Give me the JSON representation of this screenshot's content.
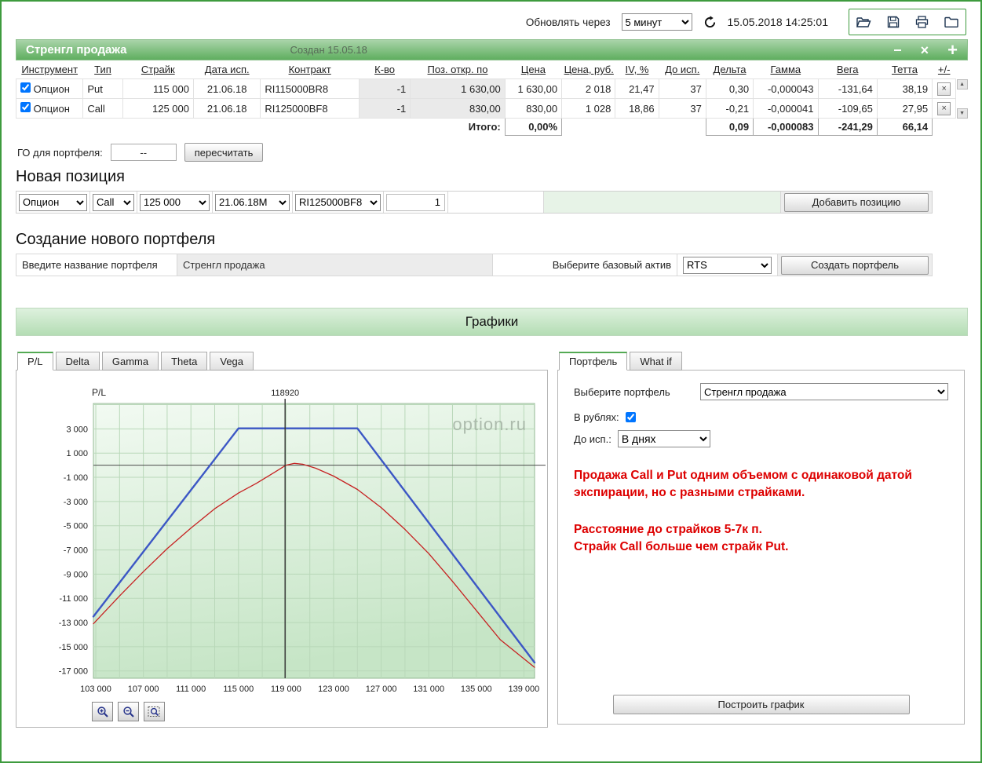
{
  "topbar": {
    "refresh_label": "Обновлять через",
    "refresh_value": "5 минут",
    "datetime": "15.05.2018 14:25:01"
  },
  "glyphs": {
    "scroll_up": "▲",
    "scroll_down": "▼",
    "row_delete": "×",
    "minimize": "−",
    "close": "×",
    "add": "+"
  },
  "portfolio": {
    "title": "Стренгл продажа",
    "created": "Создан 15.05.18",
    "table": {
      "columns": [
        "Инструмент",
        "Тип",
        "Страйк",
        "Дата исп.",
        "Контракт",
        "К-во",
        "Поз. откр. по",
        "Цена",
        "Цена, руб.",
        "IV, %",
        "До исп.",
        "Дельта",
        "Гамма",
        "Вега",
        "Тетта",
        "+/-"
      ],
      "rows": [
        {
          "checked": true,
          "instrument": "Опцион",
          "type": "Put",
          "strike": "115 000",
          "exp_date": "21.06.18",
          "contract": "RI115000BR8",
          "qty": "-1",
          "open_pos": "1 630,00",
          "price": "1 630,00",
          "price_rub": "2 018",
          "iv": "21,47",
          "days": "37",
          "delta": "0,30",
          "gamma": "-0,000043",
          "vega": "-131,64",
          "theta": "38,19"
        },
        {
          "checked": true,
          "instrument": "Опцион",
          "type": "Call",
          "strike": "125 000",
          "exp_date": "21.06.18",
          "contract": "RI125000BF8",
          "qty": "-1",
          "open_pos": "830,00",
          "price": "830,00",
          "price_rub": "1 028",
          "iv": "18,86",
          "days": "37",
          "delta": "-0,21",
          "gamma": "-0,000041",
          "vega": "-109,65",
          "theta": "27,95"
        }
      ],
      "totals": {
        "label": "Итого:",
        "percent": "0,00%",
        "delta": "0,09",
        "gamma": "-0,000083",
        "vega": "-241,29",
        "theta": "66,14"
      }
    },
    "go_label": "ГО для портфеля:",
    "go_value": "--",
    "recalc_button": "пересчитать"
  },
  "new_position": {
    "title": "Новая позиция",
    "instrument": "Опцион",
    "option_type": "Call",
    "strike": "125 000",
    "date": "21.06.18M",
    "contract": "RI125000BF8",
    "qty": "1",
    "add_button": "Добавить позицию"
  },
  "create_portfolio": {
    "title": "Создание нового портфеля",
    "name_label": "Введите название портфеля",
    "name_value": "Стренгл продажа",
    "asset_label": "Выберите базовый актив",
    "asset_value": "RTS",
    "create_button": "Создать портфель"
  },
  "charts_section": {
    "band_title": "Графики",
    "left_tabs": [
      "P/L",
      "Delta",
      "Gamma",
      "Theta",
      "Vega"
    ],
    "active_left_tab": "P/L"
  },
  "right_panel": {
    "tabs": [
      "Портфель",
      "What if"
    ],
    "active_tab": "Портфель",
    "select_portfolio_label": "Выберите портфель",
    "select_portfolio_value": "Стренгл продажа",
    "rub_label": "В рублях:",
    "rub_checked": true,
    "days_label": "До исп.:",
    "days_value": "В днях",
    "note1": "Продажа Call и Put одним объемом с одинаковой датой экспирации, но с разными страйками.",
    "note2": "Расстояние до страйков 5-7к п.",
    "note3": "Страйк Call больше чем страйк Put.",
    "build_button": "Построить график"
  },
  "chart_data": {
    "type": "line",
    "ylabel": "P/L",
    "watermark": "option.ru",
    "current_price": 118920,
    "current_price_label": "118920",
    "xlim": [
      102800,
      139900
    ],
    "ylim": [
      -17600,
      5100
    ],
    "grid_step_x": 2000,
    "grid_step_y": 2000,
    "x_ticks": [
      103000,
      107000,
      111000,
      115000,
      119000,
      123000,
      127000,
      131000,
      135000,
      139000
    ],
    "x_tick_labels": [
      "103 000",
      "107 000",
      "111 000",
      "115 000",
      "119 000",
      "123 000",
      "127 000",
      "131 000",
      "135 000",
      "139 000"
    ],
    "y_ticks": [
      3000,
      1000,
      -1000,
      -3000,
      -5000,
      -7000,
      -9000,
      -11000,
      -13000,
      -15000,
      -17000
    ],
    "y_tick_labels": [
      "3 000",
      "1 000",
      "-1 000",
      "-3 000",
      "-5 000",
      "-7 000",
      "-9 000",
      "-11 000",
      "-13 000",
      "-15 000",
      "-17 000"
    ],
    "series": [
      {
        "name": "expiration-payoff",
        "color": "#3c57c5",
        "width": 2.4,
        "points": [
          [
            102800,
            -12500
          ],
          [
            115000,
            3046
          ],
          [
            125000,
            3046
          ],
          [
            139900,
            -16300
          ]
        ]
      },
      {
        "name": "current-pl",
        "color": "#c62222",
        "width": 1.3,
        "points": [
          [
            102800,
            -13100
          ],
          [
            105000,
            -10800
          ],
          [
            107000,
            -8800
          ],
          [
            109000,
            -6900
          ],
          [
            111000,
            -5200
          ],
          [
            113000,
            -3600
          ],
          [
            115000,
            -2300
          ],
          [
            116500,
            -1500
          ],
          [
            118000,
            -600
          ],
          [
            119000,
            0
          ],
          [
            119700,
            150
          ],
          [
            120400,
            80
          ],
          [
            121500,
            -250
          ],
          [
            123000,
            -900
          ],
          [
            125000,
            -2000
          ],
          [
            127000,
            -3500
          ],
          [
            129000,
            -5300
          ],
          [
            131000,
            -7300
          ],
          [
            133000,
            -9600
          ],
          [
            135000,
            -12000
          ],
          [
            137000,
            -14400
          ],
          [
            139900,
            -16700
          ]
        ]
      }
    ]
  }
}
